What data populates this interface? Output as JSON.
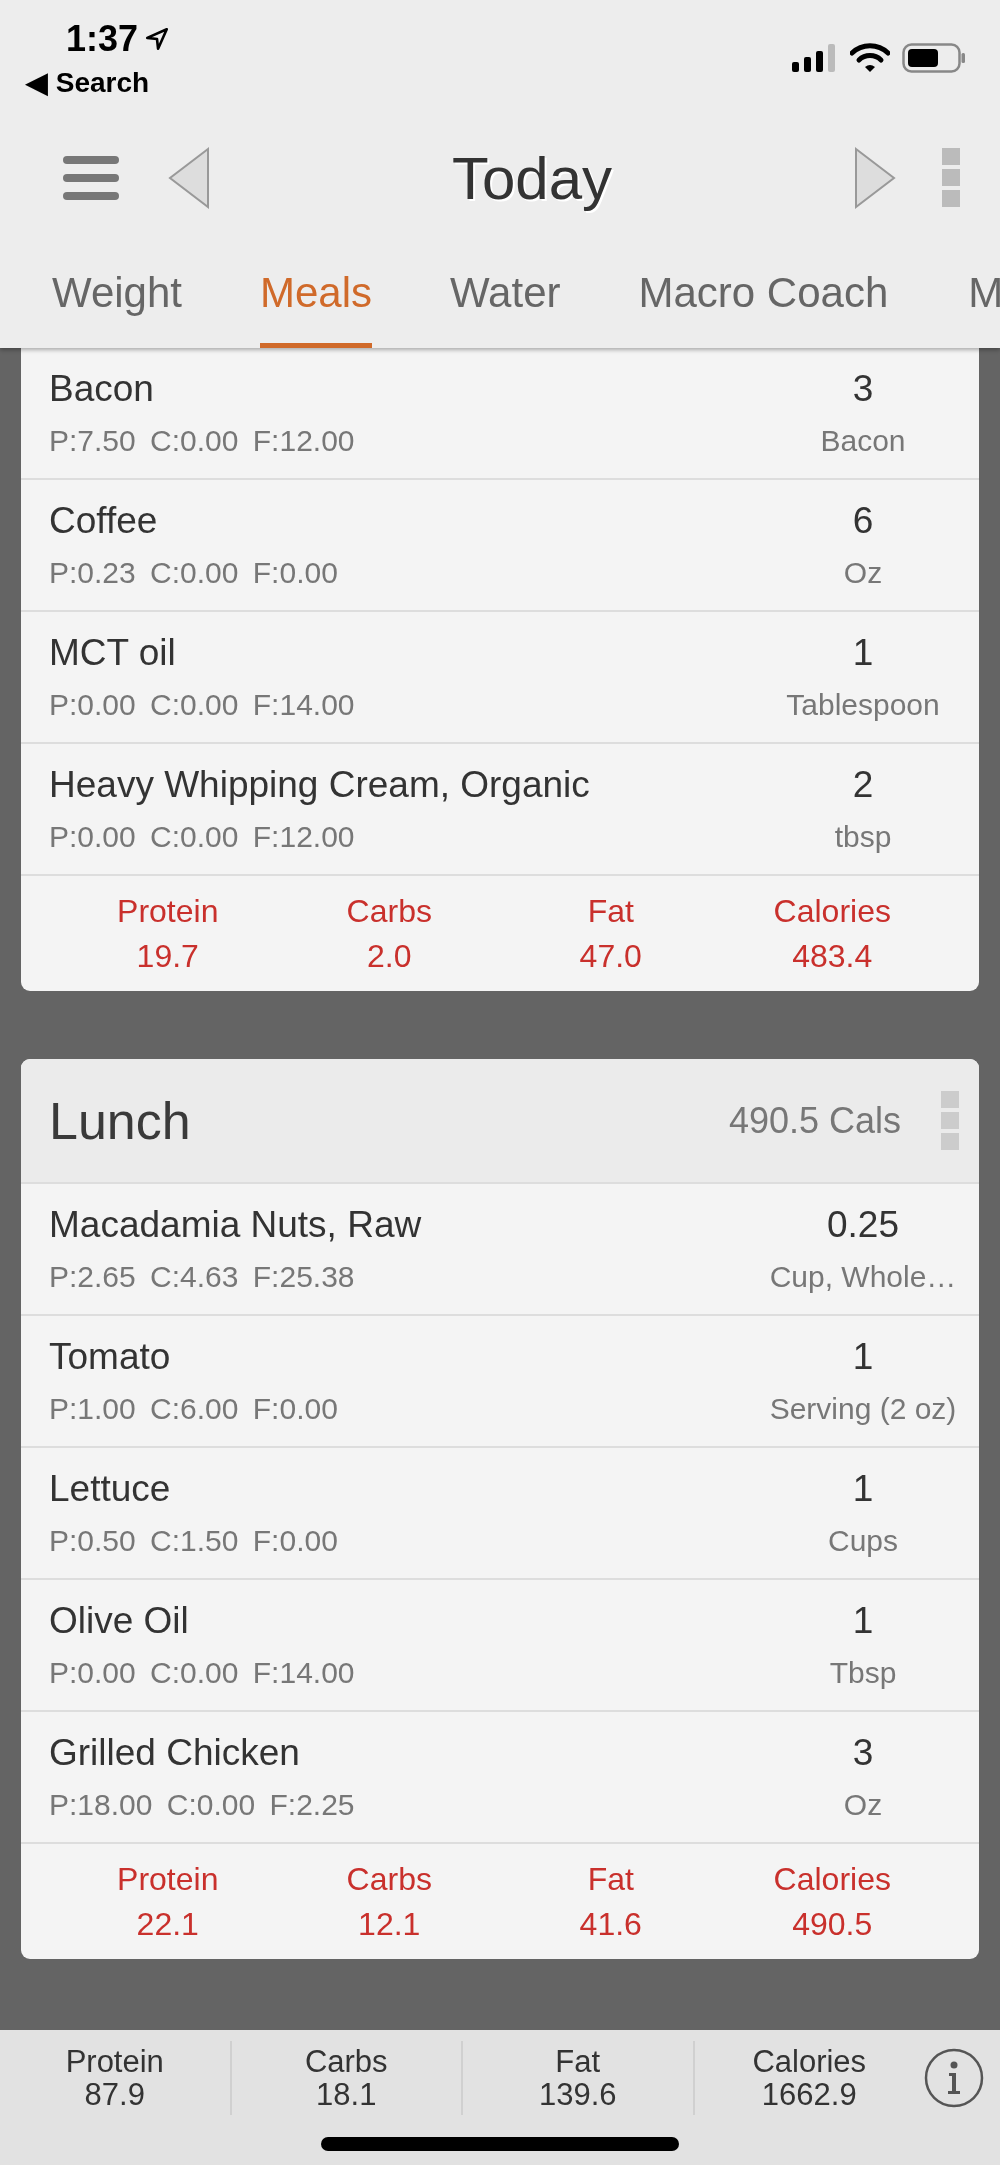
{
  "status_bar": {
    "time": "1:37",
    "back": "◀ Search"
  },
  "nav": {
    "title": "Today"
  },
  "tabs": [
    {
      "label": "Weight",
      "selected": false
    },
    {
      "label": "Meals",
      "selected": true
    },
    {
      "label": "Water",
      "selected": false
    },
    {
      "label": "Macro Coach",
      "selected": false
    },
    {
      "label": "M",
      "selected": false
    }
  ],
  "meals": [
    {
      "items": [
        {
          "name": "Bacon",
          "macros": "P:7.50 C:0.00 F:12.00",
          "amount": "3",
          "unit": "Bacon"
        },
        {
          "name": "Coffee",
          "macros": "P:0.23 C:0.00 F:0.00",
          "amount": "6",
          "unit": "Oz"
        },
        {
          "name": "MCT oil",
          "macros": "P:0.00 C:0.00 F:14.00",
          "amount": "1",
          "unit": "Tablespoon"
        },
        {
          "name": "Heavy Whipping Cream, Organic",
          "macros": "P:0.00 C:0.00 F:12.00",
          "amount": "2",
          "unit": "tbsp"
        }
      ],
      "totals": [
        {
          "label": "Protein",
          "value": "19.7"
        },
        {
          "label": "Carbs",
          "value": "2.0"
        },
        {
          "label": "Fat",
          "value": "47.0"
        },
        {
          "label": "Calories",
          "value": "483.4"
        }
      ]
    },
    {
      "title": "Lunch",
      "calories": "490.5 Cals",
      "items": [
        {
          "name": "Macadamia Nuts, Raw",
          "macros": "P:2.65 C:4.63 F:25.38",
          "amount": "0.25",
          "unit": "Cup, Whole…"
        },
        {
          "name": "Tomato",
          "macros": "P:1.00 C:6.00 F:0.00",
          "amount": "1",
          "unit": "Serving (2 oz)"
        },
        {
          "name": "Lettuce",
          "macros": "P:0.50 C:1.50 F:0.00",
          "amount": "1",
          "unit": "Cups"
        },
        {
          "name": "Olive Oil",
          "macros": "P:0.00 C:0.00 F:14.00",
          "amount": "1",
          "unit": "Tbsp"
        },
        {
          "name": "Grilled Chicken",
          "macros": "P:18.00 C:0.00 F:2.25",
          "amount": "3",
          "unit": "Oz"
        }
      ],
      "totals": [
        {
          "label": "Protein",
          "value": "22.1"
        },
        {
          "label": "Carbs",
          "value": "12.1"
        },
        {
          "label": "Fat",
          "value": "41.6"
        },
        {
          "label": "Calories",
          "value": "490.5"
        }
      ]
    }
  ],
  "summary": [
    {
      "label": "Protein",
      "value": "87.9"
    },
    {
      "label": "Carbs",
      "value": "18.1"
    },
    {
      "label": "Fat",
      "value": "139.6"
    },
    {
      "label": "Calories",
      "value": "1662.9"
    }
  ]
}
